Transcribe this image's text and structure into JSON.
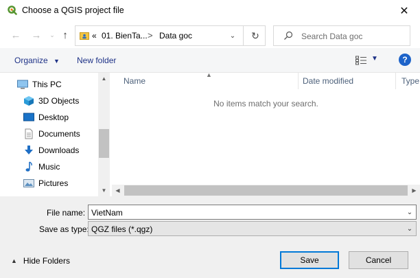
{
  "window": {
    "title": "Choose a QGIS project file",
    "close_icon": "close-icon",
    "logo_icon": "qgis-logo"
  },
  "navigation": {
    "back_icon": "arrow-left-icon",
    "forward_icon": "arrow-right-icon",
    "up_icon": "arrow-up-icon",
    "breadcrumb": {
      "overflow": "«",
      "items": [
        "01. BienTa...",
        "Data goc"
      ],
      "separator": ">"
    },
    "refresh_icon": "refresh-icon",
    "search_placeholder": "Search Data goc"
  },
  "toolbar": {
    "organize_label": "Organize",
    "new_folder_label": "New folder",
    "view_icon": "view-details-icon",
    "help_icon": "help-icon",
    "help_label": "?"
  },
  "sidebar": {
    "items": [
      {
        "label": "This PC",
        "icon": "computer-icon"
      },
      {
        "label": "3D Objects",
        "icon": "cube-icon"
      },
      {
        "label": "Desktop",
        "icon": "desktop-icon"
      },
      {
        "label": "Documents",
        "icon": "documents-icon"
      },
      {
        "label": "Downloads",
        "icon": "download-icon"
      },
      {
        "label": "Music",
        "icon": "music-icon"
      },
      {
        "label": "Pictures",
        "icon": "pictures-icon"
      }
    ]
  },
  "file_list": {
    "columns": [
      "Name",
      "Date modified",
      "Type"
    ],
    "sort_column": "Name",
    "empty_message": "No items match your search."
  },
  "form": {
    "file_name_label": "File name:",
    "file_name_value": "VietNam",
    "save_type_label": "Save as type:",
    "save_type_value": "QGZ files (*.qgz)"
  },
  "footer": {
    "hide_folders_label": "Hide Folders",
    "save_label": "Save",
    "cancel_label": "Cancel"
  },
  "colors": {
    "accent": "#0078d7",
    "link": "#1e3287",
    "help": "#1d63c9",
    "qgis_green": "#589632"
  }
}
